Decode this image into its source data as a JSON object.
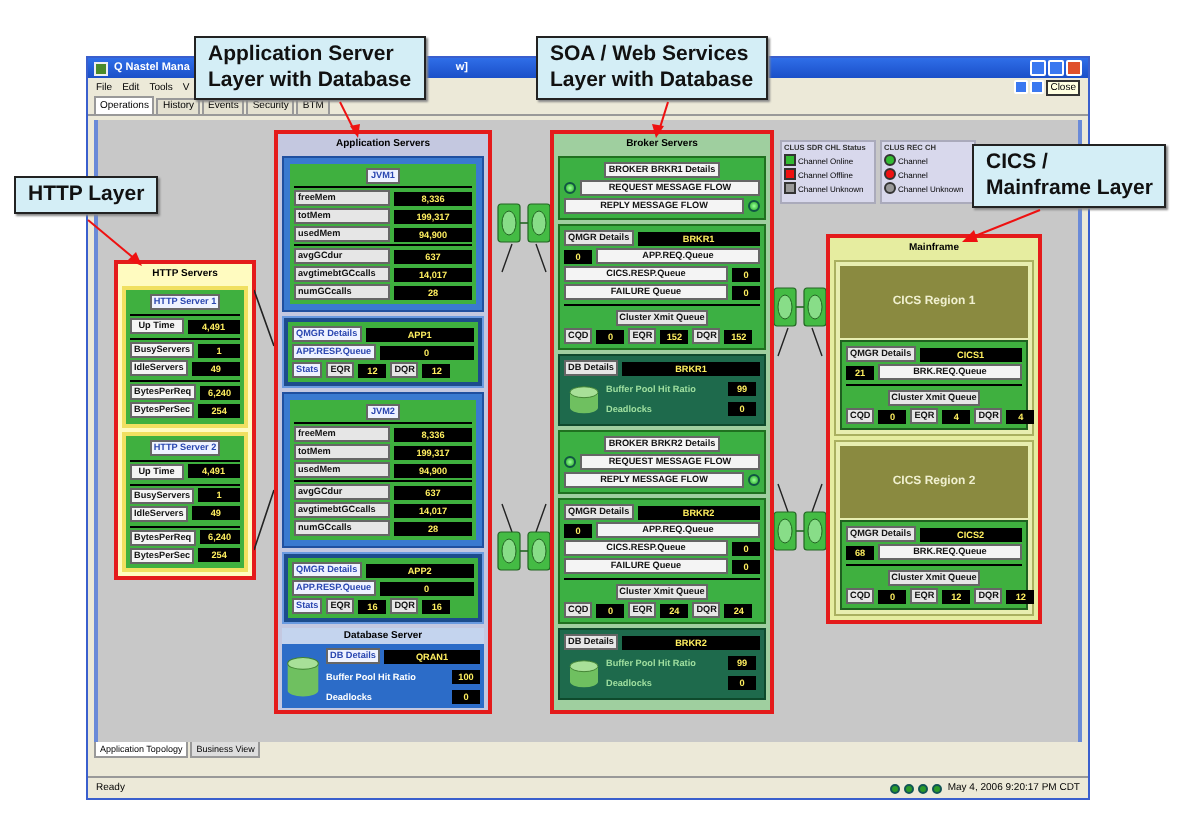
{
  "callouts": [
    {
      "lines": [
        "Application Server",
        "Layer with Database"
      ]
    },
    {
      "lines": [
        "SOA / Web Services",
        "Layer with Database"
      ]
    },
    {
      "lines": [
        "HTTP Layer"
      ]
    },
    {
      "lines": [
        "CICS /",
        "Mainframe Layer"
      ]
    }
  ],
  "window": {
    "title": "Q Nastel Mana",
    "title_tail": "w]",
    "close_tooltip": "Close"
  },
  "menu": [
    "File",
    "Edit",
    "Tools",
    "V"
  ],
  "tabs": [
    {
      "label": "Operations",
      "selected": true
    },
    {
      "label": "History",
      "selected": false
    },
    {
      "label": "Events",
      "selected": false
    },
    {
      "label": "Security",
      "selected": false
    },
    {
      "label": "BTM",
      "selected": false
    }
  ],
  "http": {
    "title": "HTTP Servers",
    "servers": [
      {
        "name": "HTTP Server 1",
        "groups": [
          [
            {
              "label": "Up Time",
              "value": "4,491"
            }
          ],
          [
            {
              "label": "BusyServers",
              "value": "1"
            },
            {
              "label": "IdleServers",
              "value": "49"
            }
          ],
          [
            {
              "label": "BytesPerReq",
              "value": "6,240"
            },
            {
              "label": "BytesPerSec",
              "value": "254"
            }
          ]
        ]
      },
      {
        "name": "HTTP Server 2",
        "groups": [
          [
            {
              "label": "Up Time",
              "value": "4,491"
            }
          ],
          [
            {
              "label": "BusyServers",
              "value": "1"
            },
            {
              "label": "IdleServers",
              "value": "49"
            }
          ],
          [
            {
              "label": "BytesPerReq",
              "value": "6,240"
            },
            {
              "label": "BytesPerSec",
              "value": "254"
            }
          ]
        ]
      }
    ]
  },
  "app": {
    "title": "Application Servers",
    "jvms": [
      {
        "name": "JVM1",
        "groups": [
          [
            {
              "label": "freeMem",
              "value": "8,336"
            },
            {
              "label": "totMem",
              "value": "199,317"
            },
            {
              "label": "usedMem",
              "value": "94,900"
            }
          ],
          [
            {
              "label": "avgGCdur",
              "value": "637"
            },
            {
              "label": "avgtimebtGCcalls",
              "value": "14,017"
            },
            {
              "label": "numGCcalls",
              "value": "28"
            }
          ]
        ],
        "qmgr": {
          "details": "QMGR Details",
          "name": "APP1",
          "queue": "APP.RESP.Queue",
          "depth": "0",
          "stats": "Stats",
          "counters": [
            {
              "label": "EQR",
              "value": "12"
            },
            {
              "label": "DQR",
              "value": "12"
            }
          ]
        }
      },
      {
        "name": "JVM2",
        "groups": [
          [
            {
              "label": "freeMem",
              "value": "8,336"
            },
            {
              "label": "totMem",
              "value": "199,317"
            },
            {
              "label": "usedMem",
              "value": "94,900"
            }
          ],
          [
            {
              "label": "avgGCdur",
              "value": "637"
            },
            {
              "label": "avgtimebtGCcalls",
              "value": "14,017"
            },
            {
              "label": "numGCcalls",
              "value": "28"
            }
          ]
        ],
        "qmgr": {
          "details": "QMGR Details",
          "name": "APP2",
          "queue": "APP.RESP.Queue",
          "depth": "0",
          "stats": "Stats",
          "counters": [
            {
              "label": "EQR",
              "value": "16"
            },
            {
              "label": "DQR",
              "value": "16"
            }
          ]
        }
      }
    ],
    "database": {
      "title": "Database Server",
      "details": "DB Details",
      "name": "QRAN1",
      "metrics": [
        {
          "label": "Buffer Pool Hit Ratio",
          "value": "100"
        },
        {
          "label": "Deadlocks",
          "value": "0"
        }
      ]
    }
  },
  "broker": {
    "title": "Broker Servers",
    "brokers": [
      {
        "name": "BROKER BRKR1 Details",
        "flows": [
          {
            "label": "REQUEST MESSAGE FLOW",
            "kind": "light-left"
          },
          {
            "label": "REPLY MESSAGE FLOW",
            "kind": "light-right"
          }
        ],
        "qmgr": {
          "details": "QMGR Details",
          "name": "BRKR1",
          "queues": [
            {
              "label": "APP.REQ.Queue",
              "value": "0",
              "kind": "value-left"
            },
            {
              "label": "CICS.RESP.Queue",
              "value": "0",
              "kind": "value-right"
            },
            {
              "label": "FAILURE Queue",
              "value": "0",
              "kind": "value-right"
            }
          ],
          "xmit": "Cluster Xmit Queue",
          "counters": [
            {
              "label": "CQD",
              "value": "0"
            },
            {
              "label": "EQR",
              "value": "152"
            },
            {
              "label": "DQR",
              "value": "152"
            }
          ]
        },
        "database": {
          "details": "DB Details",
          "name": "BRKR1",
          "metrics": [
            {
              "label": "Buffer Pool Hit Ratio",
              "value": "99"
            },
            {
              "label": "Deadlocks",
              "value": "0"
            }
          ]
        }
      },
      {
        "name": "BROKER BRKR2 Details",
        "flows": [
          {
            "label": "REQUEST MESSAGE FLOW",
            "kind": "light-left"
          },
          {
            "label": "REPLY MESSAGE FLOW",
            "kind": "light-right"
          }
        ],
        "qmgr": {
          "details": "QMGR Details",
          "name": "BRKR2",
          "queues": [
            {
              "label": "APP.REQ.Queue",
              "value": "0",
              "kind": "value-left"
            },
            {
              "label": "CICS.RESP.Queue",
              "value": "0",
              "kind": "value-right"
            },
            {
              "label": "FAILURE Queue",
              "value": "0",
              "kind": "value-right"
            }
          ],
          "xmit": "Cluster Xmit Queue",
          "counters": [
            {
              "label": "CQD",
              "value": "0"
            },
            {
              "label": "EQR",
              "value": "24"
            },
            {
              "label": "DQR",
              "value": "24"
            }
          ]
        },
        "database": {
          "details": "DB Details",
          "name": "BRKR2",
          "metrics": [
            {
              "label": "Buffer Pool Hit Ratio",
              "value": "99"
            },
            {
              "label": "Deadlocks",
              "value": "0"
            }
          ]
        }
      }
    ]
  },
  "legends": [
    {
      "title": "CLUS SDR CHL Status",
      "kind": "square",
      "items": [
        {
          "label": "Channel Online",
          "color": "#33bb33"
        },
        {
          "label": "Channel Offline",
          "color": "#ee1111"
        },
        {
          "label": "Channel Unknown",
          "color": "#999999"
        }
      ]
    },
    {
      "title": "CLUS REC CH",
      "kind": "circle",
      "items": [
        {
          "label": "Channel",
          "color": "#33bb33"
        },
        {
          "label": "Channel",
          "color": "#ee1111"
        },
        {
          "label": "Channel Unknown",
          "color": "#999999"
        }
      ]
    }
  ],
  "mainframe": {
    "title": "Mainframe",
    "regions": [
      {
        "name": "CICS Region 1",
        "qmgr": {
          "details": "QMGR Details",
          "name": "CICS1",
          "depth": "21",
          "queue": "BRK.REQ.Queue",
          "xmit": "Cluster Xmit Queue",
          "counters": [
            {
              "label": "CQD",
              "value": "0"
            },
            {
              "label": "EQR",
              "value": "4"
            },
            {
              "label": "DQR",
              "value": "4"
            }
          ]
        }
      },
      {
        "name": "CICS Region 2",
        "qmgr": {
          "details": "QMGR Details",
          "name": "CICS2",
          "depth": "68",
          "queue": "BRK.REQ.Queue",
          "xmit": "Cluster Xmit Queue",
          "counters": [
            {
              "label": "CQD",
              "value": "0"
            },
            {
              "label": "EQR",
              "value": "12"
            },
            {
              "label": "DQR",
              "value": "12"
            }
          ]
        }
      }
    ]
  },
  "bottom_tabs": [
    {
      "label": "Application Topology",
      "selected": true
    },
    {
      "label": "Business View",
      "selected": false
    }
  ],
  "status_bar": {
    "text": "Ready",
    "datetime": "May 4, 2006 9:20:17 PM CDT"
  }
}
